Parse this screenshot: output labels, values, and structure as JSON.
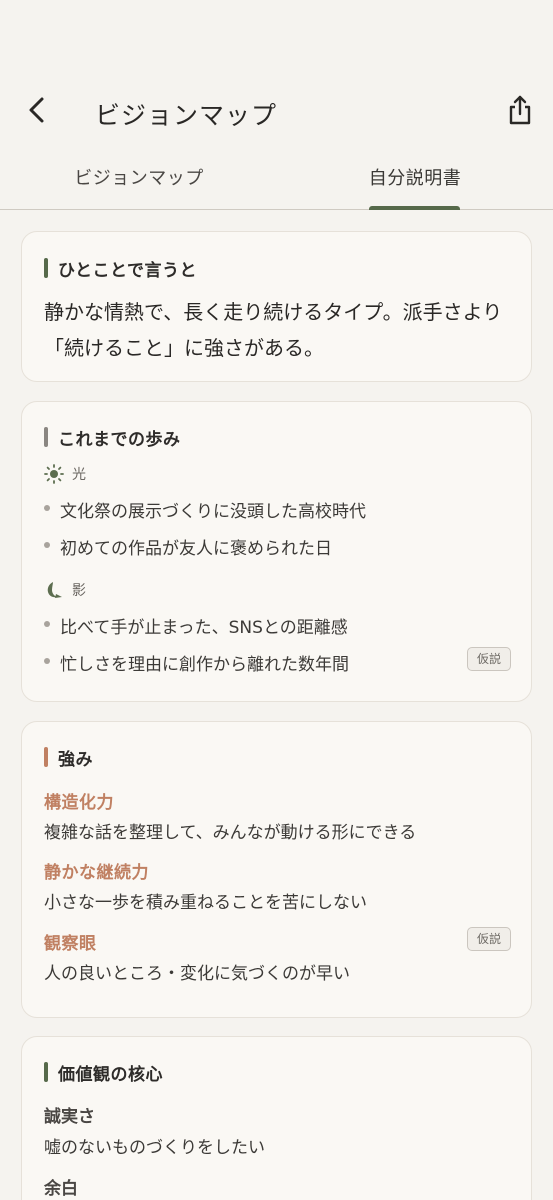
{
  "header": {
    "title": "ビジョンマップ",
    "back_icon": "chevron-left-icon",
    "share_icon": "share-icon"
  },
  "tabs": [
    {
      "label": "ビジョンマップ",
      "active": false
    },
    {
      "label": "自分説明書",
      "active": true
    }
  ],
  "colors": {
    "accent_green": "#56694a",
    "accent_terracotta": "#c08062",
    "bar_gray": "#8a8681"
  },
  "summary": {
    "title": "ひとことで言うと",
    "text": "静かな情熱で、長く走り続けるタイプ。派手さより「続けること」に強さがある。"
  },
  "journey": {
    "title": "これまでの歩み",
    "light": {
      "label": "光",
      "icon": "sun-icon",
      "items": [
        "文化祭の展示づくりに没頭した高校時代",
        "初めての作品が友人に褒められた日"
      ]
    },
    "shadow": {
      "label": "影",
      "icon": "moon-icon",
      "items": [
        "比べて手が止まった、SNSとの距離感",
        "忙しさを理由に創作から離れた数年間"
      ],
      "badge": "仮説"
    }
  },
  "strengths": {
    "title": "強み",
    "items": [
      {
        "name": "構造化力",
        "desc": "複雑な話を整理して、みんなが動ける形にできる"
      },
      {
        "name": "静かな継続力",
        "desc": "小さな一歩を積み重ねることを苦にしない"
      },
      {
        "name": "観察眼",
        "desc": "人の良いところ・変化に気づくのが早い",
        "badge": "仮説"
      }
    ]
  },
  "values": {
    "title": "価値観の核心",
    "items": [
      {
        "name": "誠実さ",
        "desc": "嘘のないものづくりをしたい"
      },
      {
        "name": "余白",
        "desc": ""
      }
    ]
  }
}
